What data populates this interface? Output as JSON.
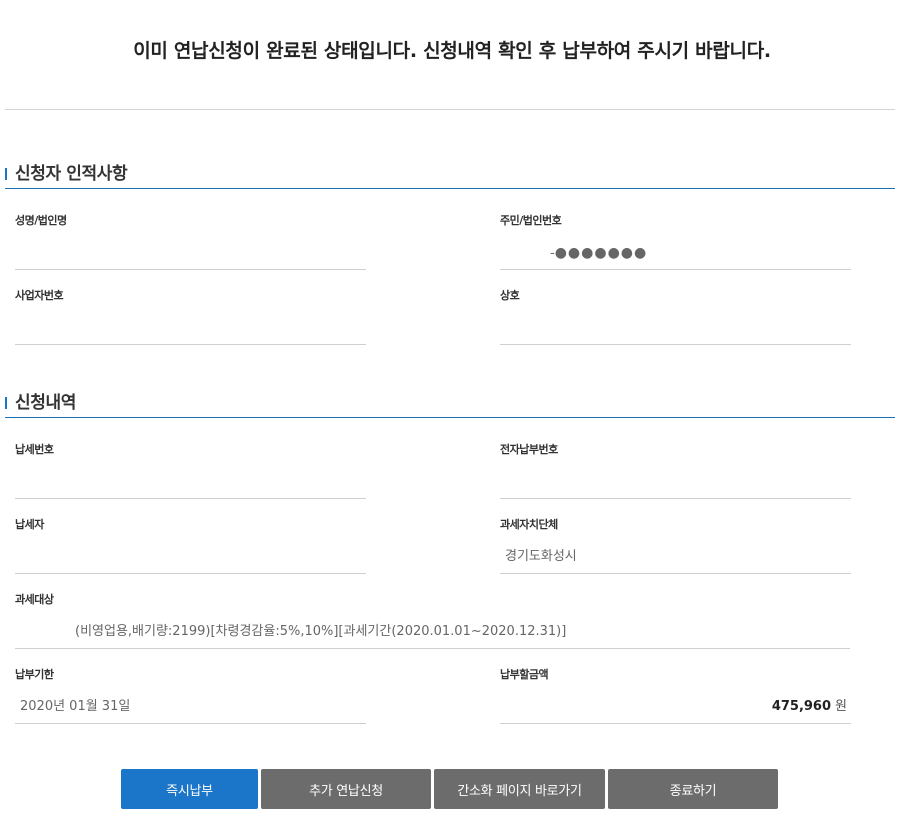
{
  "notice": "이미 연납신청이 완료된 상태입니다. 신청내역 확인 후 납부하여 주시기 바랍니다.",
  "applicant": {
    "section_title": "신청자 인적사항",
    "name_label": "성명/법인명",
    "name_value": "",
    "id_label": "주민/법인번호",
    "id_prefix": "-",
    "id_mask": "●●●●●●●",
    "bizno_label": "사업자번호",
    "bizno_value": "",
    "company_label": "상호",
    "company_value": ""
  },
  "details": {
    "section_title": "신청내역",
    "tax_no_label": "납세번호",
    "tax_no_value": "",
    "epay_no_label": "전자납부번호",
    "epay_no_value": "",
    "taxpayer_label": "납세자",
    "taxpayer_value": "",
    "local_gov_label": "과세자치단체",
    "local_gov_value": "경기도화성시",
    "target_label": "과세대상",
    "target_value": "(비영업용,배기량:2199)[차령경감율:5%,10%][과세기간(2020.01.01~2020.12.31)]",
    "due_label": "납부기한",
    "due_value": "2020년 01월 31일",
    "amount_label": "납부할금액",
    "amount_value": "475,960",
    "amount_unit": "원"
  },
  "buttons": {
    "pay_now": "즉시납부",
    "add_annual": "추가 연납신청",
    "simple_page": "간소화 페이지 바로가기",
    "exit": "종료하기"
  },
  "colors": {
    "primary": "#1b75c8",
    "gray_button": "#6c6c6c",
    "section_line": "#1b6fb5"
  }
}
